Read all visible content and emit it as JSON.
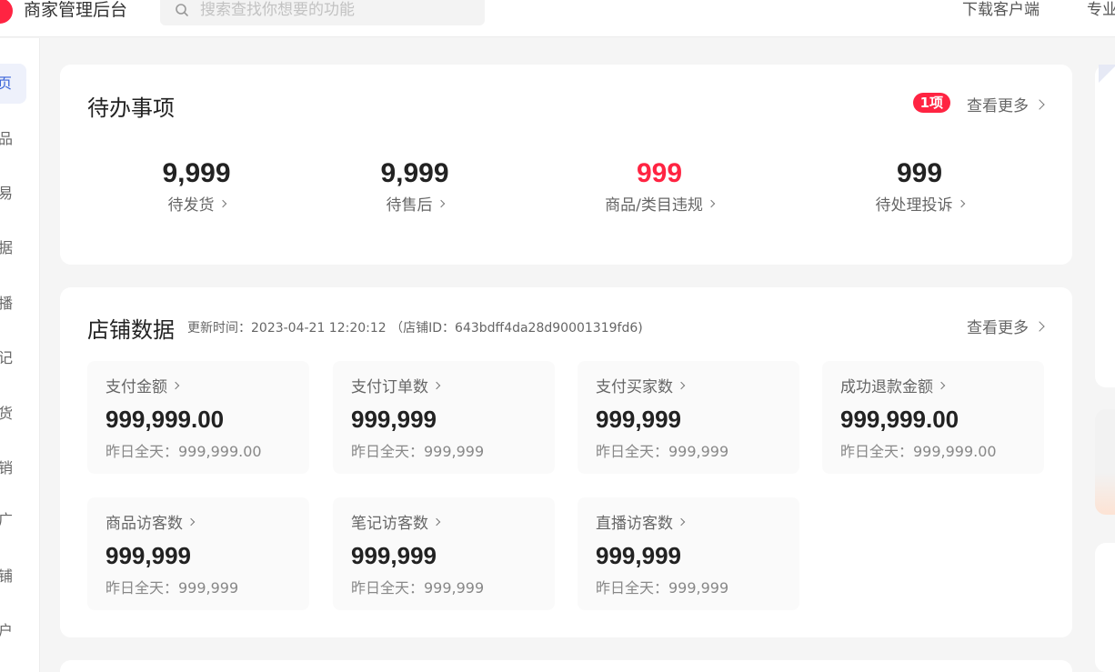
{
  "header": {
    "title": "商家管理后台",
    "search_placeholder": "搜索查找你想要的功能",
    "download_client": "下载客户端",
    "pro_link": "专业"
  },
  "sidebar": {
    "items": [
      {
        "label": "页",
        "active": true
      },
      {
        "label": "品"
      },
      {
        "label": "易"
      },
      {
        "label": "据"
      },
      {
        "label": "播"
      },
      {
        "label": "记"
      },
      {
        "label": "货"
      },
      {
        "label": "销"
      },
      {
        "label": "广"
      },
      {
        "label": "铺"
      },
      {
        "label": "户"
      }
    ]
  },
  "todo": {
    "title": "待办事项",
    "badge": "1项",
    "view_more": "查看更多",
    "items": [
      {
        "value": "9,999",
        "label": "待发货"
      },
      {
        "value": "9,999",
        "label": "待售后"
      },
      {
        "value": "999",
        "label": "商品/类目违规",
        "highlight": true
      },
      {
        "value": "999",
        "label": "待处理投诉"
      }
    ]
  },
  "shop_data": {
    "title": "店铺数据",
    "update_info": "更新时间：2023-04-21 12:20:12 （店铺ID：643bdff4da28d90001319fd6)",
    "view_more": "查看更多",
    "metrics": [
      {
        "label": "支付金额",
        "value": "999,999.00",
        "yesterday": "昨日全天：999,999.00"
      },
      {
        "label": "支付订单数",
        "value": "999,999",
        "yesterday": "昨日全天：999,999"
      },
      {
        "label": "支付买家数",
        "value": "999,999",
        "yesterday": "昨日全天：999,999"
      },
      {
        "label": "成功退款金额",
        "value": "999,999.00",
        "yesterday": "昨日全天：999,999.00"
      },
      {
        "label": "商品访客数",
        "value": "999,999",
        "yesterday": "昨日全天：999,999"
      },
      {
        "label": "笔记访客数",
        "value": "999,999",
        "yesterday": "昨日全天：999,999"
      },
      {
        "label": "直播访客数",
        "value": "999,999",
        "yesterday": "昨日全天：999,999"
      }
    ]
  },
  "colors": {
    "brand_red": "#ff2442",
    "active_blue": "#3a64d8"
  }
}
